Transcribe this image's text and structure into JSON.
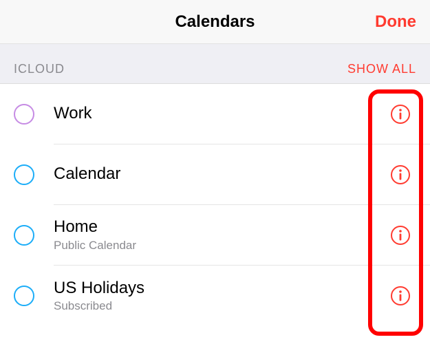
{
  "nav": {
    "title": "Calendars",
    "done": "Done"
  },
  "section": {
    "title": "ICLOUD",
    "action": "SHOW ALL"
  },
  "calendars": [
    {
      "name": "Work",
      "subtitle": "",
      "color": "purple"
    },
    {
      "name": "Calendar",
      "subtitle": "",
      "color": "blue"
    },
    {
      "name": "Home",
      "subtitle": "Public Calendar",
      "color": "blue"
    },
    {
      "name": "US Holidays",
      "subtitle": "Subscribed",
      "color": "blue"
    }
  ]
}
